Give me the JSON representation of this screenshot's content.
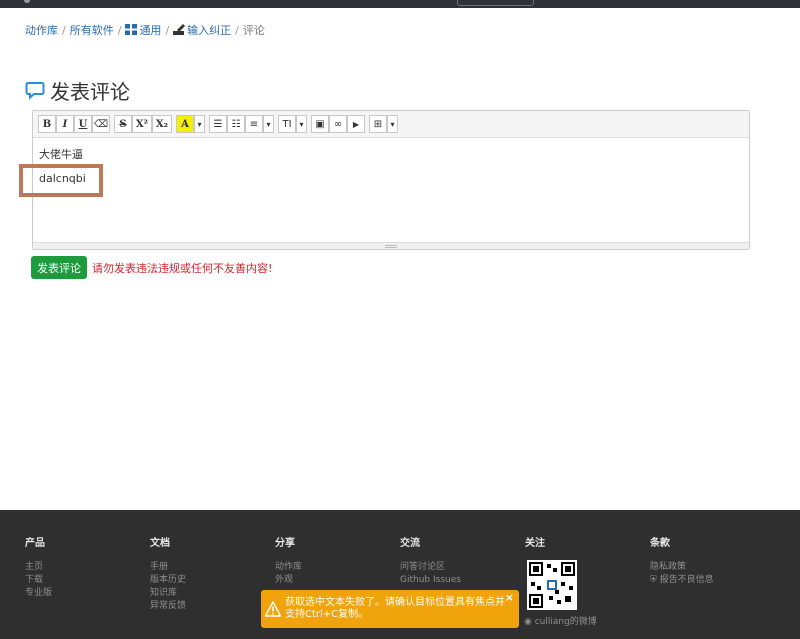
{
  "breadcrumb": {
    "items": [
      "动作库",
      "所有软件",
      "通用",
      "输入纠正"
    ],
    "current": "评论",
    "separator": "/"
  },
  "page": {
    "title": "发表评论"
  },
  "toolbar": {
    "bold": "B",
    "italic": "I",
    "underline": "U",
    "eraser": "⌫",
    "strike": "S",
    "superscript": "X²",
    "subscript": "X₂",
    "font_color": "A",
    "caret": "▾",
    "ul": "☰",
    "ol": "☷",
    "align": "≡",
    "heading": "TI",
    "image": "▣",
    "link": "∞",
    "video": "▶",
    "table": "⊞"
  },
  "editor": {
    "lines": [
      "大佬牛逼",
      "dalcnqbi"
    ]
  },
  "actions": {
    "submit_label": "发表评论",
    "warning": "请勿发表违法违规或任何不友善内容!"
  },
  "footer": {
    "columns": [
      {
        "title": "产品",
        "items": [
          "主页",
          "下载",
          "专业版"
        ]
      },
      {
        "title": "文档",
        "items": [
          "手册",
          "版本历史",
          "知识库",
          "异常反馈"
        ]
      },
      {
        "title": "分享",
        "items": [
          "动作库",
          "外观"
        ]
      },
      {
        "title": "交流",
        "items": [
          "问答讨论区",
          "Github Issues"
        ]
      },
      {
        "title": "关注",
        "items": []
      },
      {
        "title": "条款",
        "items": [
          "隐私政策",
          "报告不良信息"
        ]
      }
    ],
    "weibo": "culliang的微博"
  },
  "toast": {
    "message": "获取选中文本失败了。请确认目标位置具有焦点并支持Ctrl+C复制。",
    "close": "×"
  },
  "colors": {
    "accent": "#2a6bb0",
    "submit": "#1e9c3d",
    "warning": "#d9232e",
    "toast": "#f0a30b",
    "highlight": "#b97a57",
    "footer": "#2f2f2f"
  }
}
